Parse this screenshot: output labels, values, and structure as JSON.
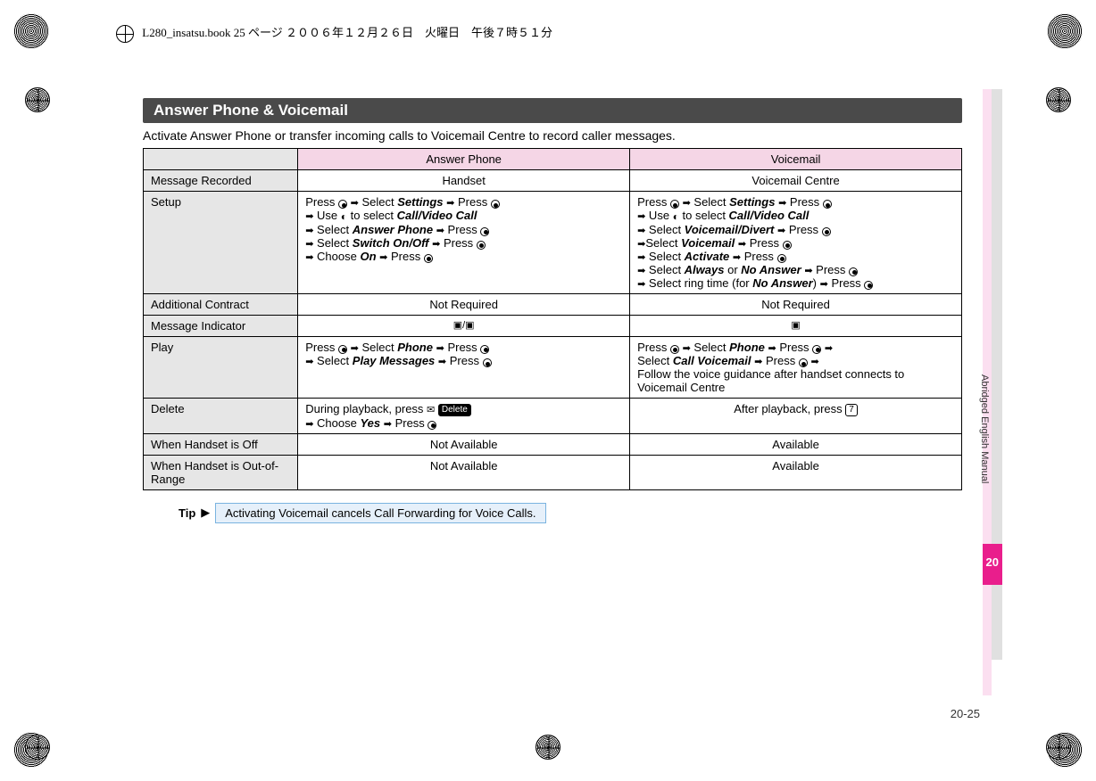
{
  "meta": {
    "book_line": "L280_insatsu.book 25 ページ ２００６年１２月２６日　火曜日　午後７時５１分"
  },
  "section": {
    "title": "Answer Phone & Voicemail",
    "intro": "Activate Answer Phone or transfer incoming calls to Voicemail Centre to record caller messages."
  },
  "chart_data": {
    "type": "table",
    "columns": [
      "",
      "Answer Phone",
      "Voicemail"
    ],
    "rows": [
      {
        "head": "Message Recorded",
        "answer": "Handset",
        "voicemail": "Voicemail Centre"
      },
      {
        "head": "Setup",
        "answer": "SETUP_AP",
        "voicemail": "SETUP_VM"
      },
      {
        "head": "Additional Contract",
        "answer": "Not Required",
        "voicemail": "Not Required"
      },
      {
        "head": "Message Indicator",
        "answer": "IND_AP",
        "voicemail": "IND_VM"
      },
      {
        "head": "Play",
        "answer": "PLAY_AP",
        "voicemail": "PLAY_VM"
      },
      {
        "head": "Delete",
        "answer": "DEL_AP",
        "voicemail": "DEL_VM"
      },
      {
        "head": "When Handset is Off",
        "answer": "Not Available",
        "voicemail": "Available"
      },
      {
        "head": "When Handset is Out-of-Range",
        "answer": "Not Available",
        "voicemail": "Available"
      }
    ]
  },
  "table": {
    "col_answer": "Answer Phone",
    "col_voicemail": "Voicemail",
    "rows": {
      "msg_recorded": {
        "head": "Message Recorded",
        "a": "Handset",
        "v": "Voicemail Centre"
      },
      "setup": {
        "head": "Setup",
        "a": {
          "l1a": "Press ",
          "l1b": " Select ",
          "settings": "Settings",
          "l1c": " Press ",
          "l2a": " Use ",
          "l2b": " to select  ",
          "cvc": "Call/Video Call",
          "l3a": " Select ",
          "ap": "Answer Phone",
          "l3b": " Press ",
          "l4a": " Select ",
          "soo": "Switch On/Off",
          "l4b": " Press ",
          "l5a": " Choose ",
          "on": "On",
          "l5b": " Press "
        },
        "v": {
          "l1a": "Press ",
          "l1b": " Select ",
          "settings": "Settings",
          "l1c": " Press ",
          "l2a": " Use ",
          "l2b": " to select ",
          "cvc": "Call/Video Call",
          "l3a": " Select ",
          "vd": "Voicemail/Divert",
          "l3b": " Press ",
          "l4a": "Select ",
          "vm": "Voicemail",
          "l4b": " Press ",
          "l5a": " Select ",
          "act": "Activate",
          "l5b": " Press ",
          "l6a": " Select ",
          "always": "Always",
          "or": " or ",
          "noans": "No Answer",
          "l6b": " Press ",
          "l7a": " Select ring time (for ",
          "noans2": "No Answer",
          "l7b": ") ",
          "l7c": " Press "
        }
      },
      "contract": {
        "head": "Additional Contract",
        "a": "Not Required",
        "v": "Not Required"
      },
      "indicator": {
        "head": "Message Indicator"
      },
      "play": {
        "head": "Play",
        "a": {
          "l1a": "Press ",
          "l1b": " Select ",
          "phone": "Phone",
          "l1c": " Press ",
          "l2a": " Select ",
          "pm": "Play Messages",
          "l2b": " Press "
        },
        "v": {
          "l1a": "Press ",
          "l1b": " Select ",
          "phone": "Phone",
          "l1c": " Press ",
          "l2a": "Select ",
          "cv": "Call Voicemail",
          "l2b": " Press ",
          "l3": "Follow the voice guidance after handset connects to Voicemail Centre"
        }
      },
      "delete": {
        "head": "Delete",
        "a": {
          "l1": "During playback, press ",
          "del": "Delete",
          "l2": " Choose ",
          "yes": "Yes",
          "l3": " Press "
        },
        "v": {
          "l1": "After playback, press ",
          "key": "7"
        }
      },
      "off": {
        "head": "When Handset is Off",
        "a": "Not Available",
        "v": "Available"
      },
      "oor": {
        "head": "When Handset is Out-of-Range",
        "a": "Not Available",
        "v": "Available"
      }
    }
  },
  "tip": {
    "label": "Tip",
    "arrow": "▶",
    "text": "Activating Voicemail cancels Call Forwarding for Voice Calls."
  },
  "side": {
    "vtext": "Abridged English Manual",
    "chapter": "20"
  },
  "page_number": "20-25",
  "keys": {
    "key7": "7"
  }
}
